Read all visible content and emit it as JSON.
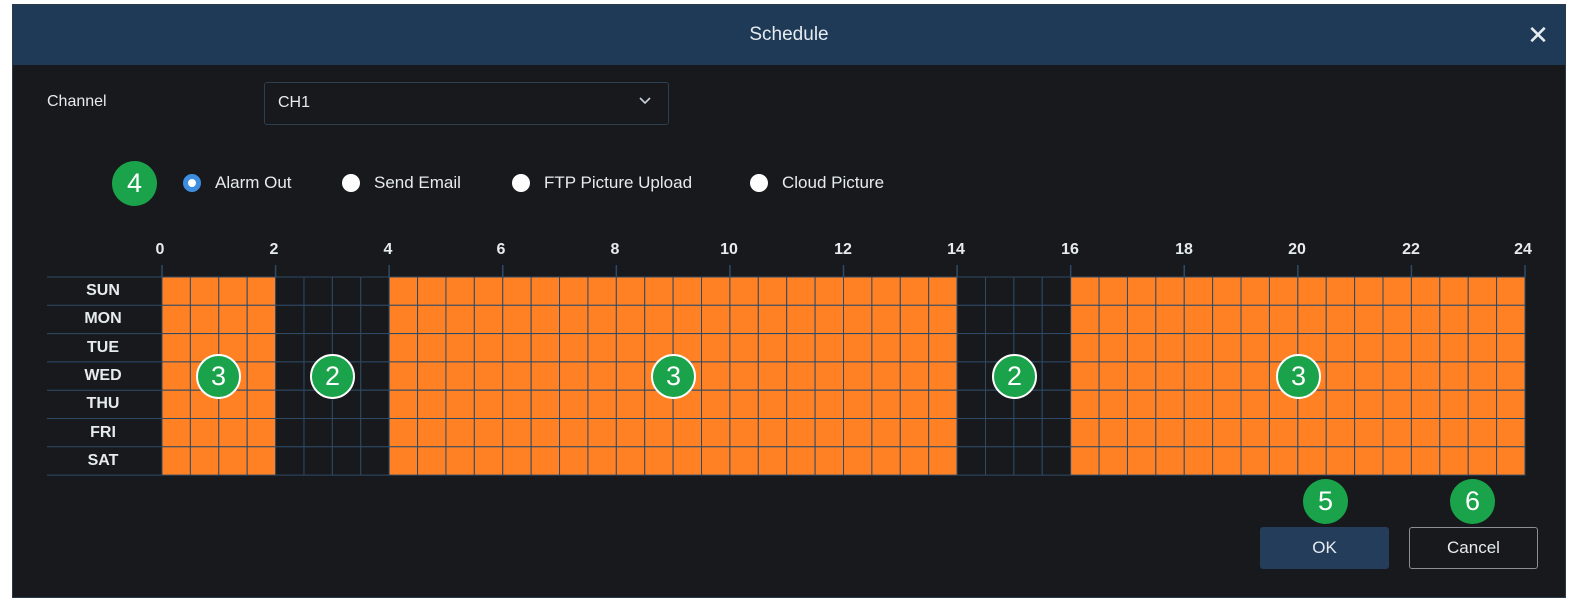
{
  "dialog": {
    "title": "Schedule",
    "close_icon": "close-icon"
  },
  "channel": {
    "label": "Channel",
    "value": "CH1",
    "dropdown_icon": "chevron-down-icon"
  },
  "actions": {
    "options": [
      {
        "label": "Alarm Out",
        "checked": true
      },
      {
        "label": "Send Email",
        "checked": false
      },
      {
        "label": "FTP Picture Upload",
        "checked": false
      },
      {
        "label": "Cloud Picture",
        "checked": false
      }
    ]
  },
  "schedule": {
    "hour_labels": [
      "0",
      "2",
      "4",
      "6",
      "8",
      "10",
      "12",
      "14",
      "16",
      "18",
      "20",
      "22",
      "24"
    ],
    "days": [
      "SUN",
      "MON",
      "TUE",
      "WED",
      "THU",
      "FRI",
      "SAT"
    ],
    "active_ranges": [
      [
        0,
        2
      ],
      [
        4,
        14
      ],
      [
        16,
        24
      ]
    ],
    "active_color": "#ff8124",
    "empty_color": "#17191c",
    "line_color": "#2e4a66"
  },
  "annotations": {
    "mode_badge": "4",
    "range_badges": [
      "3",
      "2",
      "3",
      "2",
      "3"
    ],
    "ok_badge": "5",
    "cancel_badge": "6",
    "badge_color": "#1aa34a"
  },
  "buttons": {
    "ok": "OK",
    "cancel": "Cancel"
  }
}
